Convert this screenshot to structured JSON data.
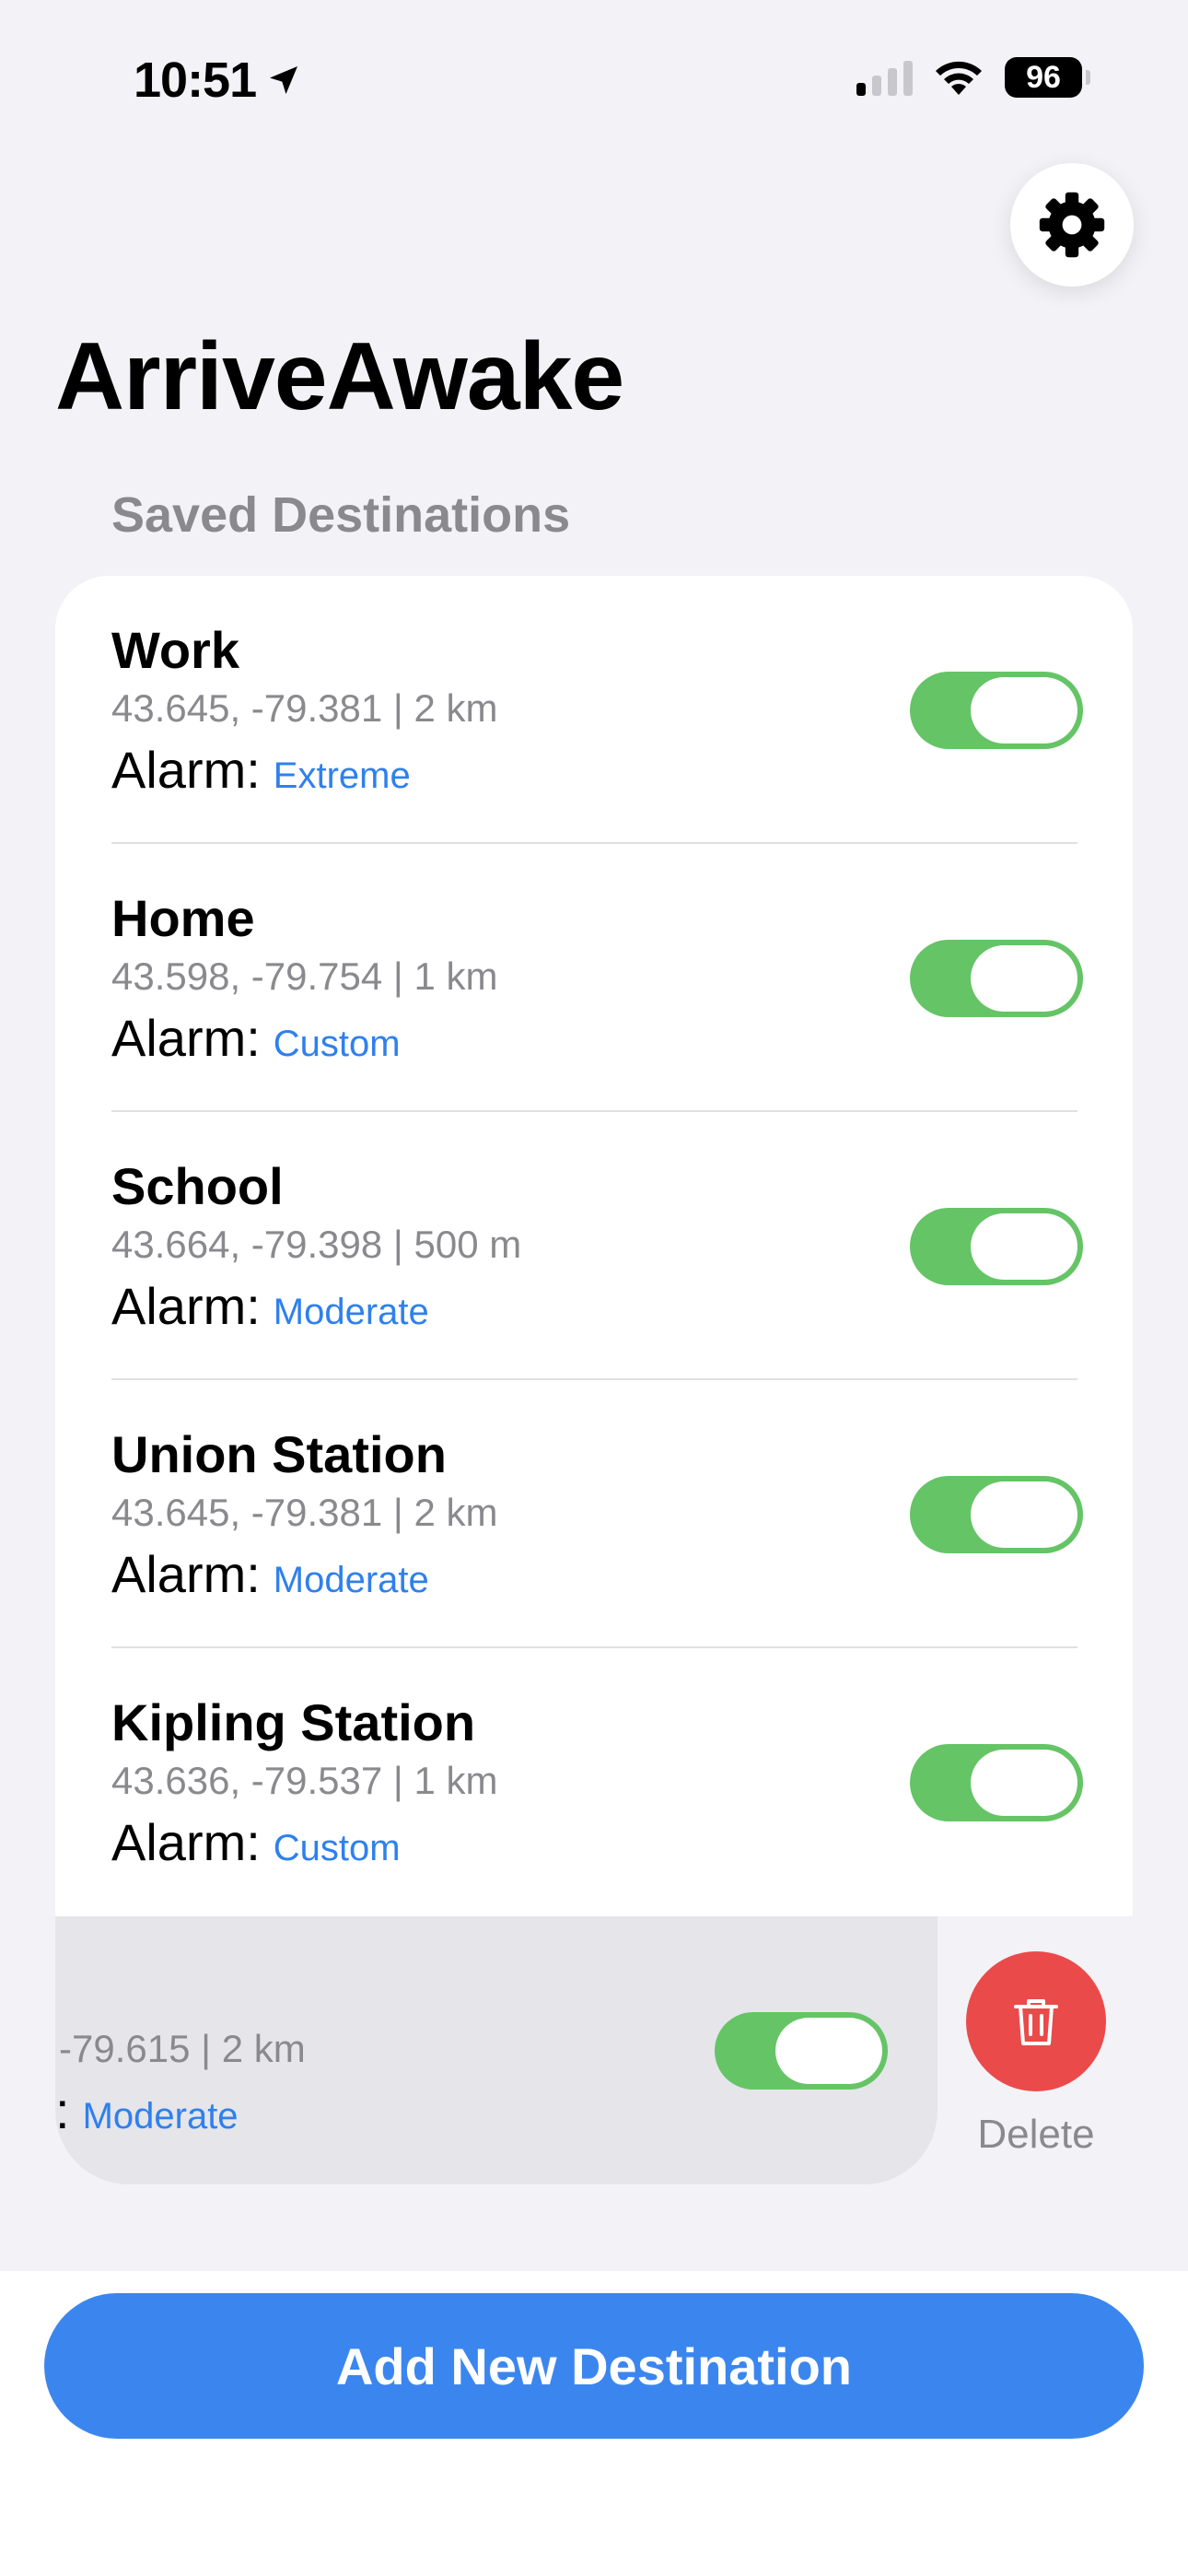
{
  "status_bar": {
    "time": "10:51",
    "battery": "96",
    "icons": [
      "location-arrow-icon",
      "cellular-signal-icon",
      "wifi-icon",
      "battery-icon"
    ]
  },
  "header": {
    "settings_icon": "gear-icon",
    "title": "ArriveAwake",
    "section_title": "Saved Destinations"
  },
  "alarm_prefix": "Alarm:",
  "destinations": [
    {
      "name": "Work",
      "coords": "43.645, -79.381 | 2 km",
      "alarm": "Extreme",
      "enabled": true
    },
    {
      "name": "Home",
      "coords": "43.598, -79.754 | 1 km",
      "alarm": "Custom",
      "enabled": true
    },
    {
      "name": "School",
      "coords": "43.664, -79.398 | 500 m",
      "alarm": "Moderate",
      "enabled": true
    },
    {
      "name": "Union Station",
      "coords": "43.645, -79.381 | 2 km",
      "alarm": "Moderate",
      "enabled": true
    },
    {
      "name": "Kipling Station",
      "coords": "43.636, -79.537 | 1 km",
      "alarm": "Custom",
      "enabled": true
    }
  ],
  "swiped_row": {
    "coords_visible": "-79.615 | 2 km",
    "alarm_prefix_visible": ":",
    "alarm": "Moderate",
    "enabled": true,
    "delete_label": "Delete",
    "delete_icon": "trash-icon"
  },
  "footer": {
    "add_button_label": "Add New Destination"
  },
  "colors": {
    "background": "#f2f2f7",
    "accent_blue": "#3b86ee",
    "toggle_green": "#65c466",
    "delete_red": "#eb4a4a",
    "secondary_text": "#8a8a8e"
  }
}
